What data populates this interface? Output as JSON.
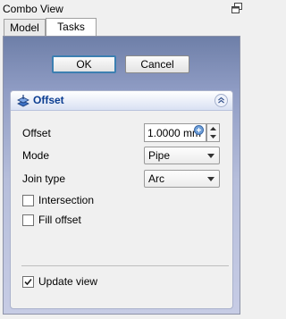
{
  "window": {
    "title": "Combo View"
  },
  "tabs": [
    {
      "label": "Model"
    },
    {
      "label": "Tasks"
    }
  ],
  "dialog": {
    "ok_label": "OK",
    "cancel_label": "Cancel"
  },
  "offset_panel": {
    "title": "Offset",
    "offset_label": "Offset",
    "offset_value": "1.0000 mm",
    "mode_label": "Mode",
    "mode_value": "Pipe",
    "join_label": "Join type",
    "join_value": "Arc",
    "intersection_label": "Intersection",
    "intersection_checked": false,
    "fill_label": "Fill offset",
    "fill_checked": false,
    "update_label": "Update view",
    "update_checked": true
  },
  "colors": {
    "title_color": "#0b3d91",
    "focus_border": "#3c7fb1"
  },
  "icons": [
    "undock-icon",
    "offset-icon",
    "collapse-icon",
    "unit-expression-icon",
    "spin-up-icon",
    "spin-down-icon",
    "dropdown-arrow-icon",
    "checkmark-icon"
  ]
}
